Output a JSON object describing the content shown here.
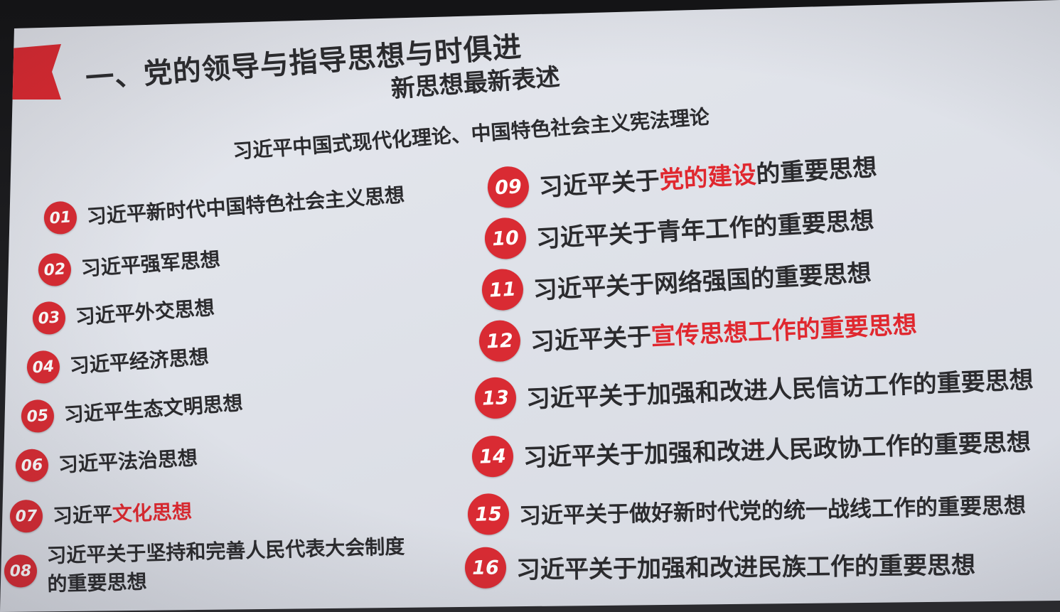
{
  "slide": {
    "title": "一、党的领导与指导思想与时俱进",
    "subtitle": "新思想最新表述",
    "theories": "习近平中国式现代化理论、中国特色社会主义宪法理论"
  },
  "items": [
    {
      "num": "01",
      "pre": "习近平新时代中国特色社会主义思想",
      "hl": "",
      "post": ""
    },
    {
      "num": "02",
      "pre": "习近平强军思想",
      "hl": "",
      "post": ""
    },
    {
      "num": "03",
      "pre": "习近平外交思想",
      "hl": "",
      "post": ""
    },
    {
      "num": "04",
      "pre": "习近平经济思想",
      "hl": "",
      "post": ""
    },
    {
      "num": "05",
      "pre": "习近平生态文明思想",
      "hl": "",
      "post": ""
    },
    {
      "num": "06",
      "pre": "习近平法治思想",
      "hl": "",
      "post": ""
    },
    {
      "num": "07",
      "pre": "习近平",
      "hl": "文化思想",
      "post": ""
    },
    {
      "num": "08",
      "pre": "习近平关于坚持和完善人民代表大会制度的重要思想",
      "hl": "",
      "post": ""
    },
    {
      "num": "09",
      "pre": "习近平关于",
      "hl": "党的建设",
      "post": "的重要思想"
    },
    {
      "num": "10",
      "pre": "习近平关于青年工作的重要思想",
      "hl": "",
      "post": ""
    },
    {
      "num": "11",
      "pre": "习近平关于网络强国的重要思想",
      "hl": "",
      "post": ""
    },
    {
      "num": "12",
      "pre": "习近平关于",
      "hl": "宣传思想工作的重要思想",
      "post": ""
    },
    {
      "num": "13",
      "pre": "习近平关于加强和改进人民信访工作的重要思想",
      "hl": "",
      "post": ""
    },
    {
      "num": "14",
      "pre": "习近平关于加强和改进人民政协工作的重要思想",
      "hl": "",
      "post": ""
    },
    {
      "num": "15",
      "pre": "习近平关于做好新时代党的统一战线工作的重要思想",
      "hl": "",
      "post": ""
    },
    {
      "num": "16",
      "pre": "习近平关于加强和改进民族工作的重要思想",
      "hl": "",
      "post": ""
    }
  ],
  "colors": {
    "accent": "#e0282f",
    "badge": "#d92b33",
    "text": "#2b2b2e",
    "slide_bg": "#e3e5eb"
  }
}
